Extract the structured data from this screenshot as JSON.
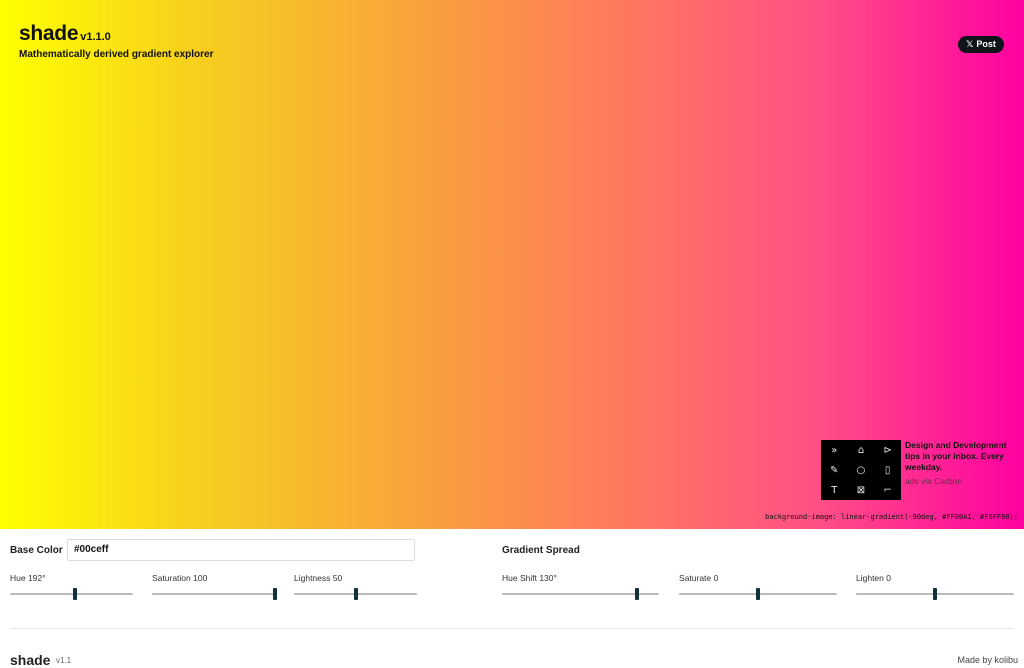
{
  "header": {
    "app_name": "shade",
    "version": "v1.1.0",
    "tagline": "Mathematically derived gradient explorer"
  },
  "share": {
    "post_label": "Post",
    "icon": "x-logo-icon"
  },
  "ad": {
    "copy": "Design and Development tips in your inbox. Every weekday.",
    "via": "ads via Carbon",
    "icons": [
      "chevrons-right-icon",
      "home-icon",
      "cursor-plus-icon",
      "pen-icon",
      "lasso-icon",
      "file-cursor-icon",
      "text-icon",
      "image-placeholder-icon",
      "corner-icon"
    ]
  },
  "gradient": {
    "css": "background-image: linear-gradient(-90deg, #FF00A1, #F6FF00);",
    "colors": {
      "start": "#FFFF00",
      "end": "#FF00A1"
    }
  },
  "controls": {
    "base_color_label": "Base Color",
    "base_color_value": "#00ceff",
    "hue": {
      "label": "Hue 192°",
      "fraction": 0.53
    },
    "saturation": {
      "label": "Saturation 100",
      "fraction": 1.0
    },
    "lightness": {
      "label": "Lightness 50",
      "fraction": 0.5
    },
    "spread_label": "Gradient Spread",
    "hue_shift": {
      "label": "Hue Shift 130°",
      "fraction": 0.86
    },
    "saturate": {
      "label": "Saturate 0",
      "fraction": 0.5
    },
    "lighten": {
      "label": "Lighten 0",
      "fraction": 0.5
    }
  },
  "footer": {
    "brand": "shade",
    "version": "v1.1",
    "right": "Made by kolibu"
  }
}
